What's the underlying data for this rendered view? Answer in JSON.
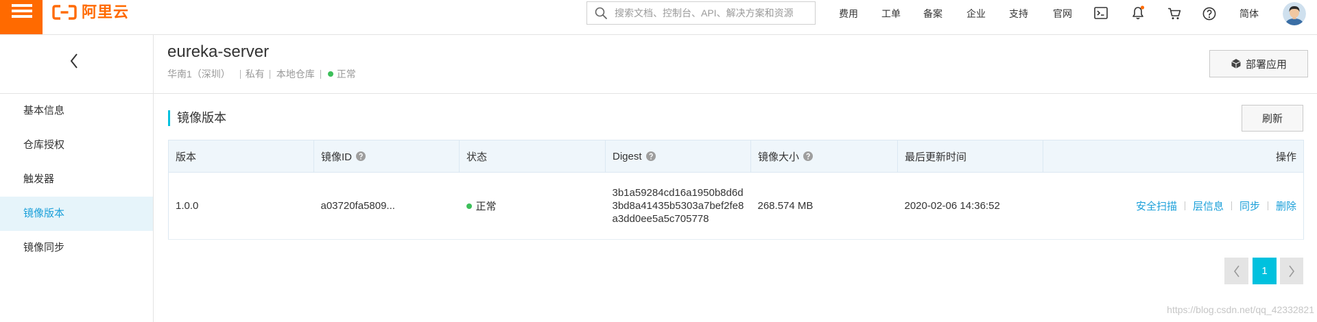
{
  "colors": {
    "brand": "#ff6a00",
    "primary": "#00c1de",
    "link": "#1a9fd9",
    "active_bg": "#e6f4fa",
    "status_ok": "#3cbf5a"
  },
  "topbar": {
    "logo_text": "阿里云",
    "search_placeholder": "搜索文档、控制台、API、解决方案和资源",
    "search_value": "",
    "nav": [
      "费用",
      "工单",
      "备案",
      "企业",
      "支持",
      "官网"
    ],
    "language": "简体",
    "has_unread_notifications": true,
    "icons": {
      "menu": "hamburger-icon",
      "logo": "aliyun-logo-icon",
      "search": "search-icon",
      "terminal": "terminal-icon",
      "notifications": "bell-icon",
      "cart": "cart-icon",
      "help": "help-icon",
      "avatar": "user-avatar"
    }
  },
  "sidebar": {
    "back_icon": "chevron-left-icon",
    "items": [
      {
        "label": "基本信息",
        "active": false
      },
      {
        "label": "仓库授权",
        "active": false
      },
      {
        "label": "触发器",
        "active": false
      },
      {
        "label": "镜像版本",
        "active": true
      },
      {
        "label": "镜像同步",
        "active": false
      }
    ]
  },
  "repository": {
    "name": "eureka-server",
    "region": "华南1（深圳）",
    "visibility": "私有",
    "source": "本地仓库",
    "status": "正常",
    "deploy_label": "部署应用",
    "deploy_icon": "cube-icon"
  },
  "section": {
    "title": "镜像版本",
    "refresh_label": "刷新"
  },
  "table": {
    "columns": [
      "版本",
      "镜像ID",
      "状态",
      "Digest",
      "镜像大小",
      "最后更新时间",
      "操作"
    ],
    "columns_with_help_icon": [
      "镜像ID",
      "Digest",
      "镜像大小"
    ],
    "rows": [
      {
        "version": "1.0.0",
        "image_id": "a03720fa5809...",
        "status": "正常",
        "digest": "3b1a59284cd16a1950b8d6d3bd8a41435b5303a7bef2fe8a3dd0ee5a5c705778",
        "size": "268.574 MB",
        "updated": "2020-02-06 14:36:52",
        "actions": [
          "安全扫描",
          "层信息",
          "同步",
          "删除"
        ]
      }
    ]
  },
  "pagination": {
    "current": "1",
    "prev_icon": "chevron-left-icon",
    "next_icon": "chevron-right-icon"
  },
  "watermark": "https://blog.csdn.net/qq_42332821"
}
